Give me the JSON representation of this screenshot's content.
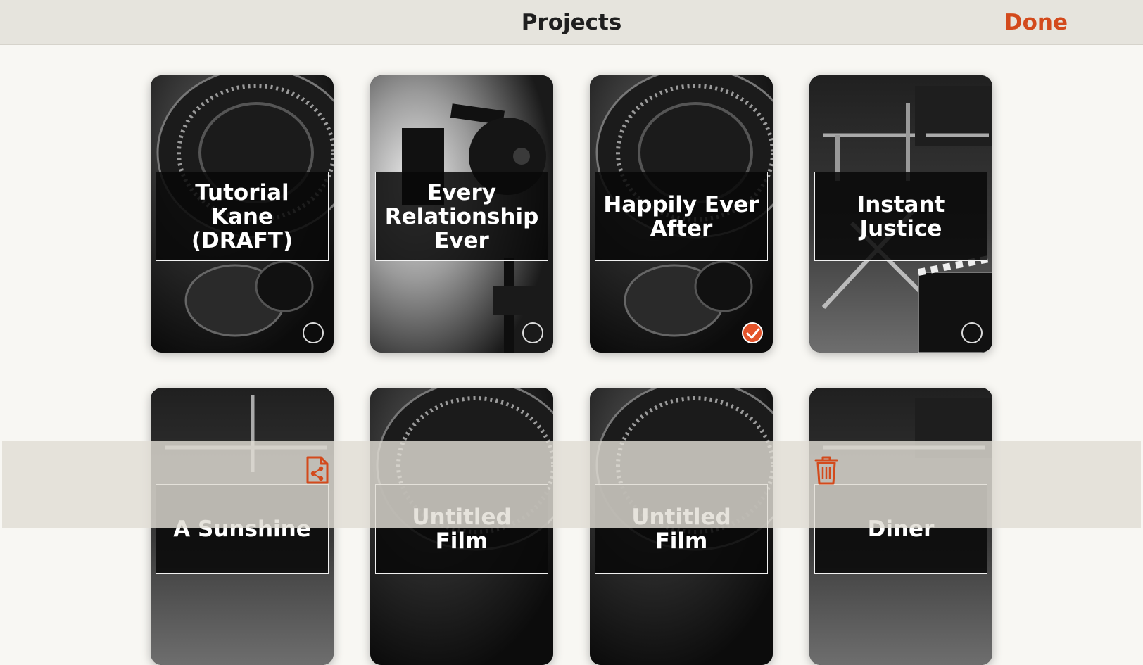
{
  "header": {
    "title": "Projects",
    "done_label": "Done"
  },
  "projects": [
    {
      "title": "Tutorial Kane (DRAFT)",
      "selected": false,
      "image": "camera-lens"
    },
    {
      "title": "Every Relationship Ever",
      "selected": false,
      "image": "studio-light"
    },
    {
      "title": "Happily Ever After",
      "selected": true,
      "image": "camera-lens"
    },
    {
      "title": "Instant Justice",
      "selected": false,
      "image": "directors-chair-clapperboard"
    },
    {
      "title": "A Sunshine",
      "selected": false,
      "image": "directors-chair"
    },
    {
      "title": "Untitled Film",
      "selected": false,
      "image": "camera-lens"
    },
    {
      "title": "Untitled Film",
      "selected": false,
      "image": "camera-lens"
    },
    {
      "title": "Diner",
      "selected": false,
      "image": "directors-chair"
    }
  ],
  "toolbar": {
    "share_icon": "share-document-icon",
    "delete_icon": "trash-icon"
  },
  "colors": {
    "accent": "#d34a1c",
    "header_bg": "#e6e4dd",
    "page_bg": "#f8f7f3"
  }
}
